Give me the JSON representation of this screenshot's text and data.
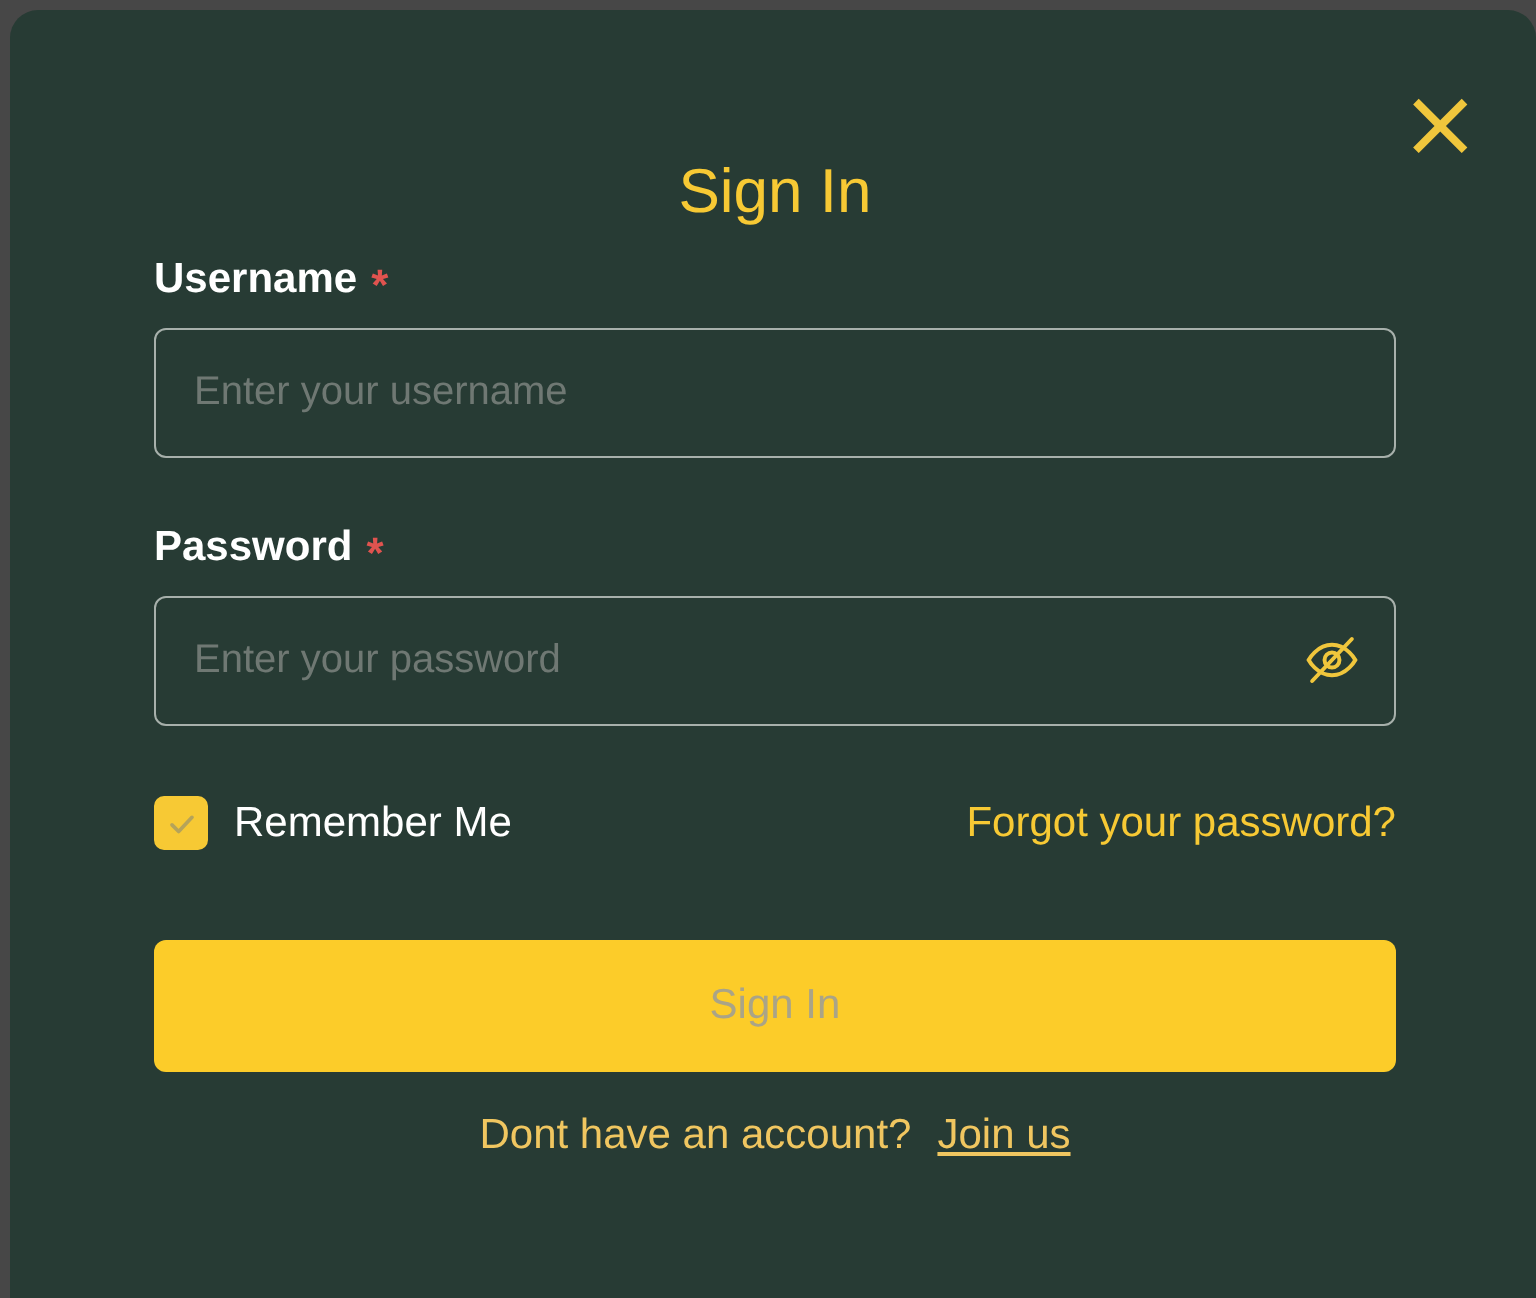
{
  "dialog": {
    "title": "Sign In",
    "close": "×"
  },
  "fields": [
    {
      "label": "Username",
      "required_mark": "*",
      "placeholder": "Enter your username",
      "kind": "text"
    },
    {
      "label": "Password",
      "required_mark": "*",
      "placeholder": "Enter your password",
      "kind": "password"
    }
  ],
  "remember": {
    "label": "Remember Me",
    "checked": true
  },
  "forgot_link": "Forgot your password?",
  "submit": {
    "label": "Sign In",
    "disabled": true
  },
  "footer": {
    "text": "Dont have an account?",
    "link": "Join us"
  }
}
